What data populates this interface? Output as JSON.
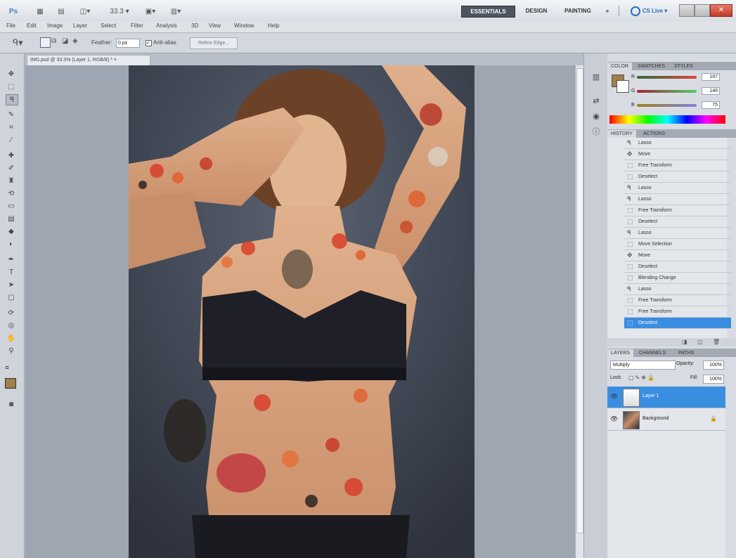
{
  "app": {
    "workspaces": [
      "ESSENTIALS",
      "DESIGN",
      "PAINTING"
    ],
    "more_workspaces": "»",
    "cslive": "CS Live ▾",
    "zoom": "33.3 ▾"
  },
  "menu": [
    "File",
    "Edit",
    "Image",
    "Layer",
    "Select",
    "Filter",
    "Analysis",
    "3D",
    "View",
    "Window",
    "Help"
  ],
  "options": {
    "feather_label": "Feather:",
    "feather_value": "0 px",
    "antialias_label": "Anti-alias",
    "refine_edge_label": "Refine Edge..."
  },
  "document": {
    "tab_label": "IMG.psd @ 33.3% (Layer 1, RGB/8) * ×"
  },
  "color_panel": {
    "tabs": [
      "COLOR",
      "SWATCHES",
      "STYLES"
    ],
    "r_label": "R",
    "g_label": "G",
    "b_label": "B",
    "r_value": "187",
    "g_value": "148",
    "b_value": "75",
    "foreground": "#a07f4a"
  },
  "history_panel": {
    "tabs": [
      "HISTORY",
      "ACTIONS"
    ],
    "items": [
      "Lasso",
      "Move",
      "Free Transform",
      "Deselect",
      "Lasso",
      "Lasso",
      "Free Transform",
      "Deselect",
      "Lasso",
      "Move Selection",
      "Move",
      "Deselect",
      "Blending Change",
      "Lasso",
      "Free Transform",
      "Free Transform",
      "Deselect"
    ]
  },
  "layers_panel": {
    "tabs": [
      "LAYERS",
      "CHANNELS",
      "PATHS"
    ],
    "blend_mode": "Multiply",
    "opacity_label": "Opacity:",
    "opacity_value": "100%",
    "lock_label": "Lock:",
    "fill_label": "Fill:",
    "fill_value": "100%",
    "layers": [
      {
        "name": "Layer 1",
        "selected": true
      },
      {
        "name": "Background",
        "selected": false
      }
    ]
  }
}
